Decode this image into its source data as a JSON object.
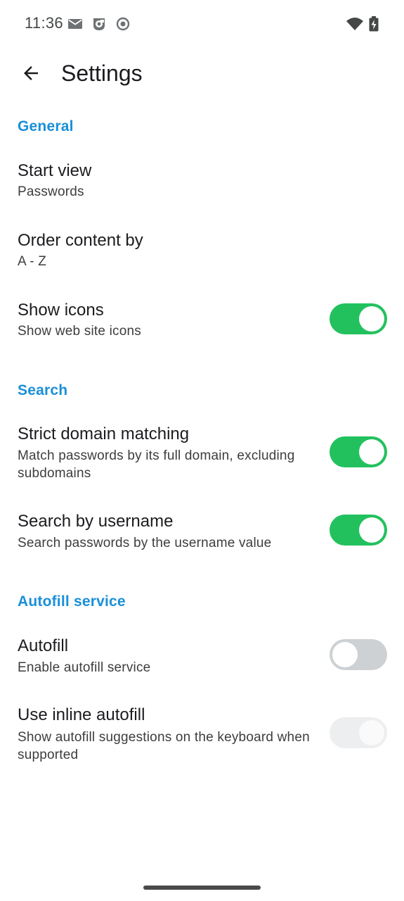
{
  "status_bar": {
    "time": "11:36",
    "icons": [
      "mail-icon",
      "app-notification-icon",
      "record-icon",
      "wifi-icon",
      "battery-charging-icon"
    ]
  },
  "app_bar": {
    "title": "Settings",
    "back_icon": "arrow-back-icon"
  },
  "sections": {
    "general": {
      "header": "General",
      "start_view": {
        "title": "Start view",
        "summary": "Passwords"
      },
      "order_content": {
        "title": "Order content by",
        "summary": "A - Z"
      },
      "show_icons": {
        "title": "Show icons",
        "summary": "Show web site icons",
        "enabled": true
      }
    },
    "search": {
      "header": "Search",
      "strict_domain": {
        "title": "Strict domain matching",
        "summary": "Match passwords by its full domain, excluding subdomains",
        "enabled": true
      },
      "search_username": {
        "title": "Search by username",
        "summary": "Search passwords by the username value",
        "enabled": true
      }
    },
    "autofill": {
      "header": "Autofill service",
      "autofill": {
        "title": "Autofill",
        "summary": "Enable autofill service",
        "enabled": false
      },
      "inline_autofill": {
        "title": "Use inline autofill",
        "summary": "Show autofill suggestions on the keyboard when supported",
        "enabled": true,
        "disabled": true
      }
    }
  },
  "colors": {
    "accent": "#1a8fd8",
    "switch_on": "#22c15e",
    "switch_off": "#cdd1d3",
    "switch_disabled": "#eceeef"
  }
}
